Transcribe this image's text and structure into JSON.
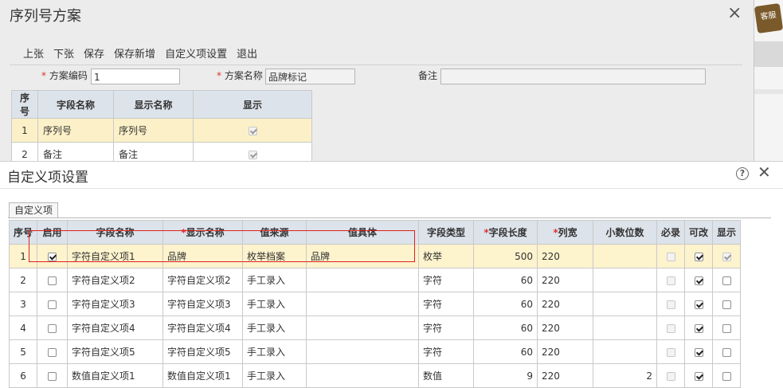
{
  "bg": {
    "title": "序列号方案",
    "toolbar": [
      "上张",
      "下张",
      "保存",
      "保存新增",
      "自定义项设置",
      "退出"
    ],
    "fields": {
      "code_label": "方案编码",
      "code_value": "1",
      "name_label": "方案名称",
      "name_value": "品牌标记",
      "remark_label": "备注",
      "remark_value": ""
    },
    "table": {
      "headers": [
        "序号",
        "字段名称",
        "显示名称",
        "显示"
      ],
      "rows": [
        {
          "no": "1",
          "field": "序列号",
          "display": "序列号",
          "show": true
        },
        {
          "no": "2",
          "field": "备注",
          "display": "备注",
          "show": true
        }
      ]
    },
    "badge": "客服"
  },
  "dialog": {
    "title": "自定义项设置",
    "help_icon": "?",
    "tab": "自定义项",
    "headers": {
      "no": "序号",
      "enabled": "启用",
      "field": "字段名称",
      "display": "显示名称",
      "source": "值来源",
      "value": "值具体",
      "type": "字段类型",
      "length": "字段长度",
      "width": "列宽",
      "decimals": "小数位数",
      "required": "必录",
      "editable": "可改",
      "show": "显示"
    },
    "rows": [
      {
        "no": "1",
        "enabled": true,
        "field": "字符自定义项1",
        "display": "品牌",
        "source": "枚举档案",
        "value": "品牌",
        "type": "枚举",
        "length": "500",
        "width": "220",
        "decimals": "",
        "required": false,
        "editable": true,
        "show": true
      },
      {
        "no": "2",
        "enabled": false,
        "field": "字符自定义项2",
        "display": "字符自定义项2",
        "source": "手工录入",
        "value": "",
        "type": "字符",
        "length": "60",
        "width": "220",
        "decimals": "",
        "required": false,
        "editable": true,
        "show": false
      },
      {
        "no": "3",
        "enabled": false,
        "field": "字符自定义项3",
        "display": "字符自定义项3",
        "source": "手工录入",
        "value": "",
        "type": "字符",
        "length": "60",
        "width": "220",
        "decimals": "",
        "required": false,
        "editable": true,
        "show": false
      },
      {
        "no": "4",
        "enabled": false,
        "field": "字符自定义项4",
        "display": "字符自定义项4",
        "source": "手工录入",
        "value": "",
        "type": "字符",
        "length": "60",
        "width": "220",
        "decimals": "",
        "required": false,
        "editable": true,
        "show": false
      },
      {
        "no": "5",
        "enabled": false,
        "field": "字符自定义项5",
        "display": "字符自定义项5",
        "source": "手工录入",
        "value": "",
        "type": "字符",
        "length": "60",
        "width": "220",
        "decimals": "",
        "required": false,
        "editable": true,
        "show": false
      },
      {
        "no": "6",
        "enabled": false,
        "field": "数值自定义项1",
        "display": "数值自定义项1",
        "source": "手工录入",
        "value": "",
        "type": "数值",
        "length": "9",
        "width": "220",
        "decimals": "2",
        "required": false,
        "editable": true,
        "show": false
      }
    ]
  }
}
